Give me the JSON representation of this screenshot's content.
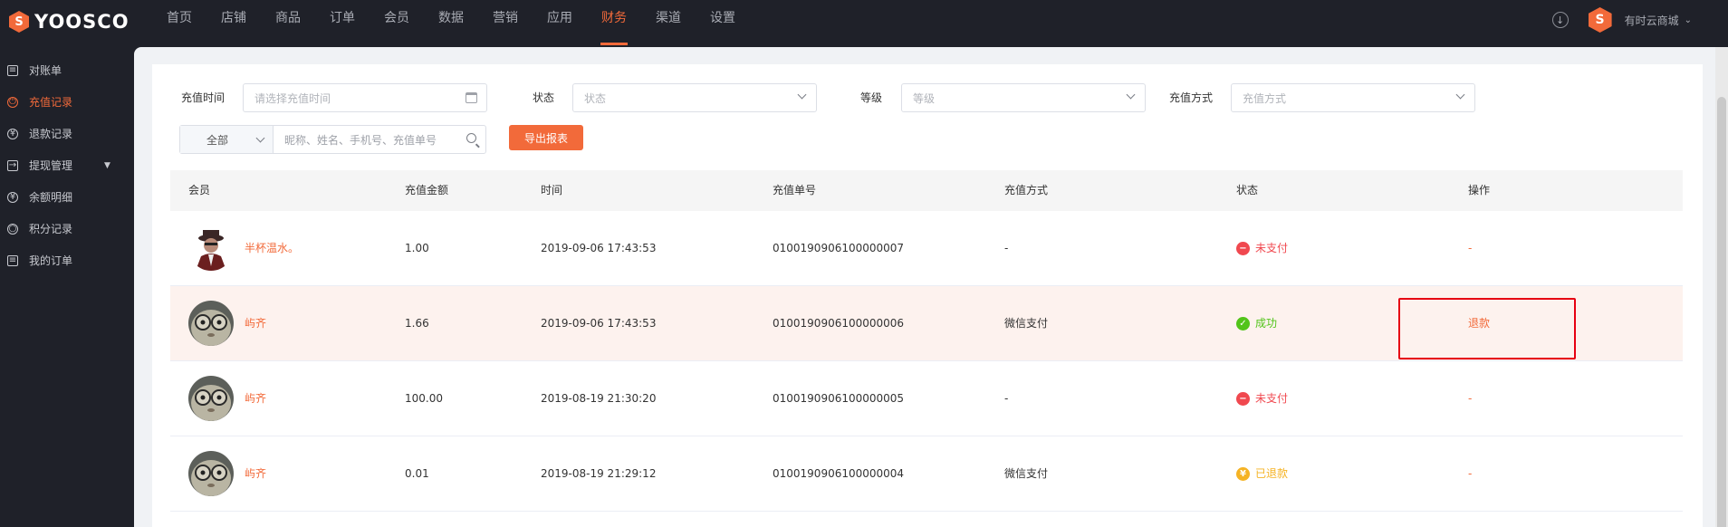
{
  "brand": {
    "name": "YOOSCO",
    "mark": "S",
    "accent": "#f26a3a"
  },
  "nav": [
    "首页",
    "店铺",
    "商品",
    "订单",
    "会员",
    "数据",
    "营销",
    "应用",
    "财务",
    "渠道",
    "设置"
  ],
  "nav_active": "财务",
  "top_right": {
    "shop_name": "有时云商城",
    "shop_mark": "S",
    "download_icon": "download-icon"
  },
  "sidebar": [
    {
      "label": "对账单",
      "icon": "document-icon",
      "active": false
    },
    {
      "label": "充值记录",
      "icon": "power-icon",
      "active": true
    },
    {
      "label": "退款记录",
      "icon": "refund-icon",
      "active": false
    },
    {
      "label": "提现管理",
      "icon": "withdraw-icon",
      "active": false,
      "has_caret": true
    },
    {
      "label": "余额明细",
      "icon": "balance-icon",
      "active": false
    },
    {
      "label": "积分记录",
      "icon": "points-icon",
      "active": false
    },
    {
      "label": "我的订单",
      "icon": "order-icon",
      "active": false
    }
  ],
  "filters": {
    "time_label": "充值时间",
    "time_placeholder": "请选择充值时间",
    "status_label": "状态",
    "status_placeholder": "状态",
    "level_label": "等级",
    "level_placeholder": "等级",
    "method_label": "充值方式",
    "method_placeholder": "充值方式",
    "scope_value": "全部",
    "search_placeholder": "昵称、姓名、手机号、充值单号",
    "export_label": "导出报表"
  },
  "table": {
    "headers": [
      "会员",
      "充值金额",
      "时间",
      "充值单号",
      "充值方式",
      "状态",
      "操作"
    ],
    "rows": [
      {
        "member": "半杯温水。",
        "amount": "1.00",
        "time": "2019-09-06 17:43:53",
        "order_no": "0100190906100000007",
        "method": "-",
        "status": "未支付",
        "status_type": "unpaid",
        "action": "-"
      },
      {
        "member": "屿齐",
        "amount": "1.66",
        "time": "2019-09-06 17:43:53",
        "order_no": "0100190906100000006",
        "method": "微信支付",
        "status": "成功",
        "status_type": "success",
        "action": "退款"
      },
      {
        "member": "屿齐",
        "amount": "100.00",
        "time": "2019-08-19 21:30:20",
        "order_no": "0100190906100000005",
        "method": "-",
        "status": "未支付",
        "status_type": "unpaid",
        "action": "-"
      },
      {
        "member": "屿齐",
        "amount": "0.01",
        "time": "2019-08-19 21:29:12",
        "order_no": "0100190906100000004",
        "method": "微信支付",
        "status": "已退款",
        "status_type": "refunded",
        "action": "-"
      }
    ]
  },
  "status_colors": {
    "unpaid": "#f0484f",
    "success": "#52c41a",
    "refunded": "#f5b324"
  }
}
